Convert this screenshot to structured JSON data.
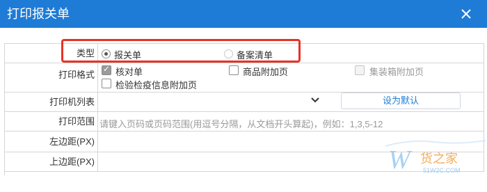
{
  "window": {
    "title": "打印报关单"
  },
  "form": {
    "type_row": {
      "label": "类型",
      "options": [
        {
          "label": "报关单",
          "selected": true
        },
        {
          "label": "备案清单",
          "selected": false
        }
      ]
    },
    "print_format_row": {
      "label": "打印格式",
      "options": [
        {
          "label": "核对单",
          "checked": true,
          "enabled": true
        },
        {
          "label": "商品附加页",
          "checked": false,
          "enabled": true
        },
        {
          "label": "集装箱附加页",
          "checked": false,
          "enabled": false
        },
        {
          "label": "检验检疫信息附加页",
          "checked": false,
          "enabled": true
        }
      ]
    },
    "printer_row": {
      "label": "打印机列表",
      "selected_value": "",
      "button_label": "设为默认"
    },
    "range_row": {
      "label": "打印范围",
      "placeholder": "请键入页码或页码范围(用逗号分隔，从文档开头算起)，例如：1,3,5-12"
    },
    "left_margin_row": {
      "label": "左边距(PX)",
      "value": ""
    },
    "top_margin_row": {
      "label": "上边距(PX)",
      "value": ""
    }
  },
  "watermark": {
    "brand": "货之家",
    "domain": "51W2C.COM"
  },
  "colors": {
    "titlebar": "#1e7bd6",
    "highlight": "#e83224",
    "accent": "#1e7bd6"
  },
  "icons": {
    "close": "close-icon",
    "dropdown": "chevron-down-icon"
  }
}
